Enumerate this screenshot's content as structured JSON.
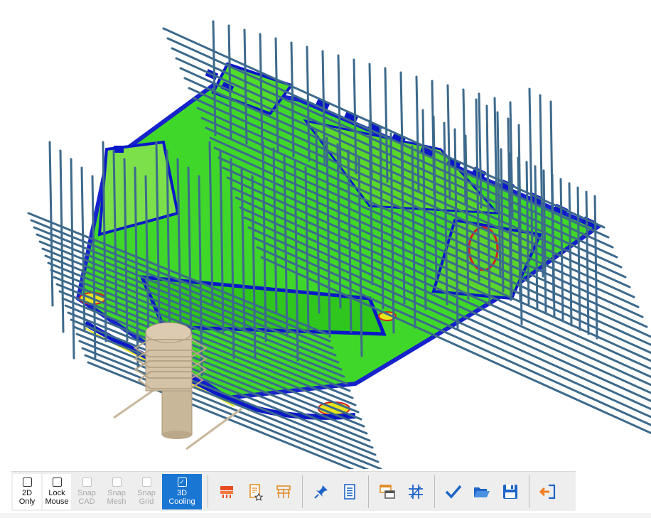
{
  "viewport": {
    "description_icon": "3d-cooling-analysis-model",
    "colors": {
      "cooling_line": "#3d6a8c",
      "mesh_green": "#35d61f",
      "mesh_blue": "#0a17c9",
      "hot_yellow": "#e6e61a",
      "hot_red": "#d62020",
      "sprue": "#c9b79a"
    }
  },
  "toolbar": {
    "toggles": [
      {
        "label": "2D\nOnly",
        "checked": false,
        "state": "enabled"
      },
      {
        "label": "Lock\nMouse",
        "checked": false,
        "state": "enabled"
      },
      {
        "label": "Snap\nCAD",
        "checked": false,
        "state": "disabled"
      },
      {
        "label": "Snap\nMesh",
        "checked": false,
        "state": "disabled"
      },
      {
        "label": "Snap\nGrid",
        "checked": false,
        "state": "disabled"
      },
      {
        "label": "3D\nCooling",
        "checked": true,
        "state": "active"
      }
    ],
    "buttons": [
      {
        "icon": "layers-red-icon"
      },
      {
        "icon": "document-star-icon"
      },
      {
        "icon": "grid-frame-icon"
      },
      {
        "icon": "pin-icon"
      },
      {
        "icon": "list-document-icon"
      },
      {
        "icon": "window-pair-icon"
      },
      {
        "icon": "grid-snap-icon"
      },
      {
        "icon": "checkmark-icon"
      },
      {
        "icon": "folder-open-icon"
      },
      {
        "icon": "save-icon"
      },
      {
        "icon": "exit-icon"
      }
    ],
    "check_glyph": "✓"
  }
}
